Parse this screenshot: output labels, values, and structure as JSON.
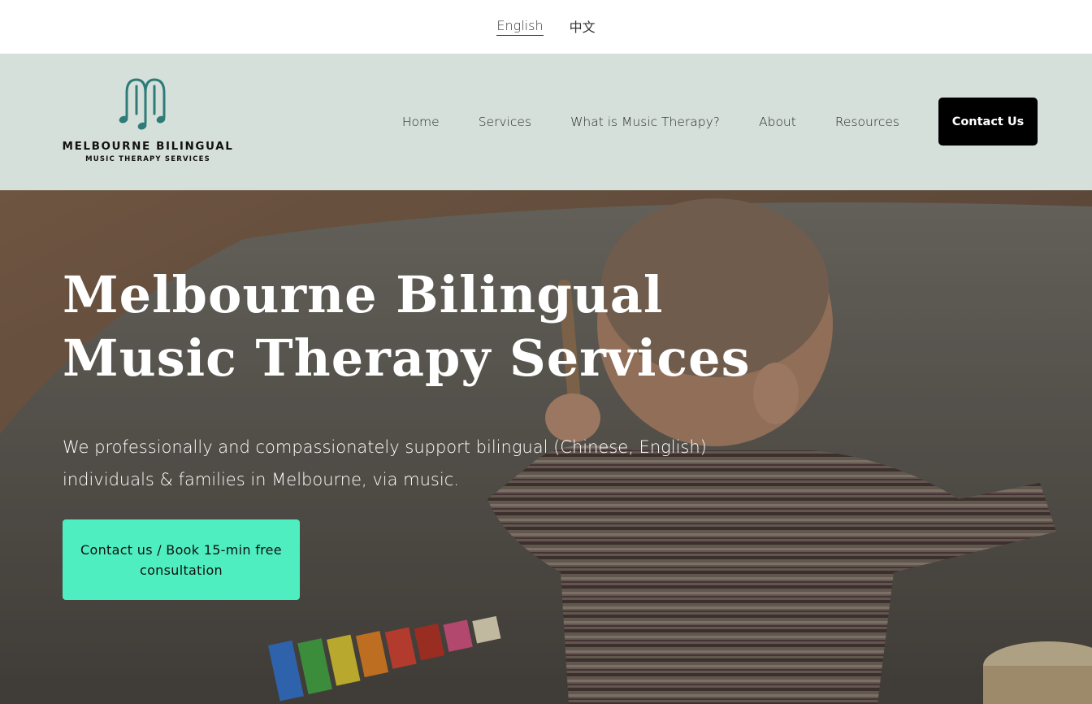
{
  "languages": [
    {
      "label": "English",
      "active": true
    },
    {
      "label": "中文",
      "active": false
    }
  ],
  "logo": {
    "title": "MELBOURNE BILINGUAL",
    "subtitle": "MUSIC THERAPY SERVICES",
    "mark_color": "#2e7b78"
  },
  "nav": {
    "items": [
      {
        "label": "Home"
      },
      {
        "label": "Services"
      },
      {
        "label": "What is Music Therapy?"
      },
      {
        "label": "About"
      },
      {
        "label": "Resources"
      }
    ],
    "contact_label": "Contact Us"
  },
  "hero": {
    "title": "Melbourne Bilingual Music Therapy Services",
    "description": "We professionally and compassionately support bilingual (Chinese, English) individuals & families in Melbourne, via music.",
    "cta_label": "Contact us / Book 15-min free consultation"
  },
  "colors": {
    "header_bg": "#d6e0db",
    "cta_bg": "#4eeec0",
    "contact_bg": "#000000"
  }
}
